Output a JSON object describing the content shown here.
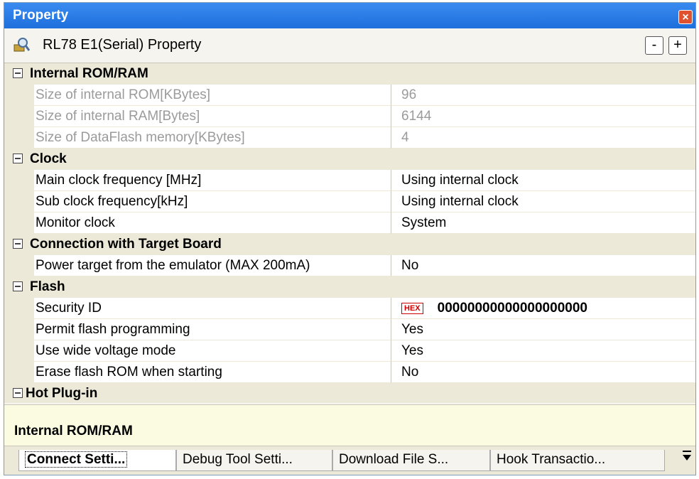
{
  "window": {
    "title": "Property"
  },
  "header": {
    "label": "RL78 E1(Serial) Property",
    "collapse_label": "-",
    "expand_label": "+"
  },
  "categories": [
    {
      "name": "Internal ROM/RAM",
      "rows": [
        {
          "name": "Size of internal ROM[KBytes]",
          "value": "96"
        },
        {
          "name": "Size of internal RAM[Bytes]",
          "value": "6144"
        },
        {
          "name": "Size of DataFlash memory[KBytes]",
          "value": "4"
        }
      ]
    },
    {
      "name": "Clock",
      "rows": [
        {
          "name": "Main clock frequency [MHz]",
          "value": "Using internal clock"
        },
        {
          "name": "Sub clock frequency[kHz]",
          "value": "Using internal clock"
        },
        {
          "name": "Monitor clock",
          "value": "System"
        }
      ]
    },
    {
      "name": "Connection with Target Board",
      "rows": [
        {
          "name": "Power target from the emulator (MAX 200mA)",
          "value": "No"
        }
      ]
    },
    {
      "name": "Flash",
      "rows": [
        {
          "name": "Security ID",
          "badge": "HEX",
          "value": "00000000000000000000"
        },
        {
          "name": "Permit flash programming",
          "value": "Yes"
        },
        {
          "name": "Use wide voltage mode",
          "value": "Yes"
        },
        {
          "name": "Erase flash ROM when starting",
          "value": "No"
        }
      ]
    },
    {
      "name": "Hot Plug-in",
      "rows": []
    }
  ],
  "description": {
    "text": "Internal ROM/RAM"
  },
  "tabs": [
    {
      "label": "Connect Setti...",
      "active": true
    },
    {
      "label": "Debug Tool Setti...",
      "active": false
    },
    {
      "label": "Download File S...",
      "active": false
    },
    {
      "label": "Hook Transactio...",
      "active": false
    }
  ],
  "icons": {
    "header": "property-icon",
    "tab_menu": "tab-menu-icon",
    "close": "close-icon"
  }
}
